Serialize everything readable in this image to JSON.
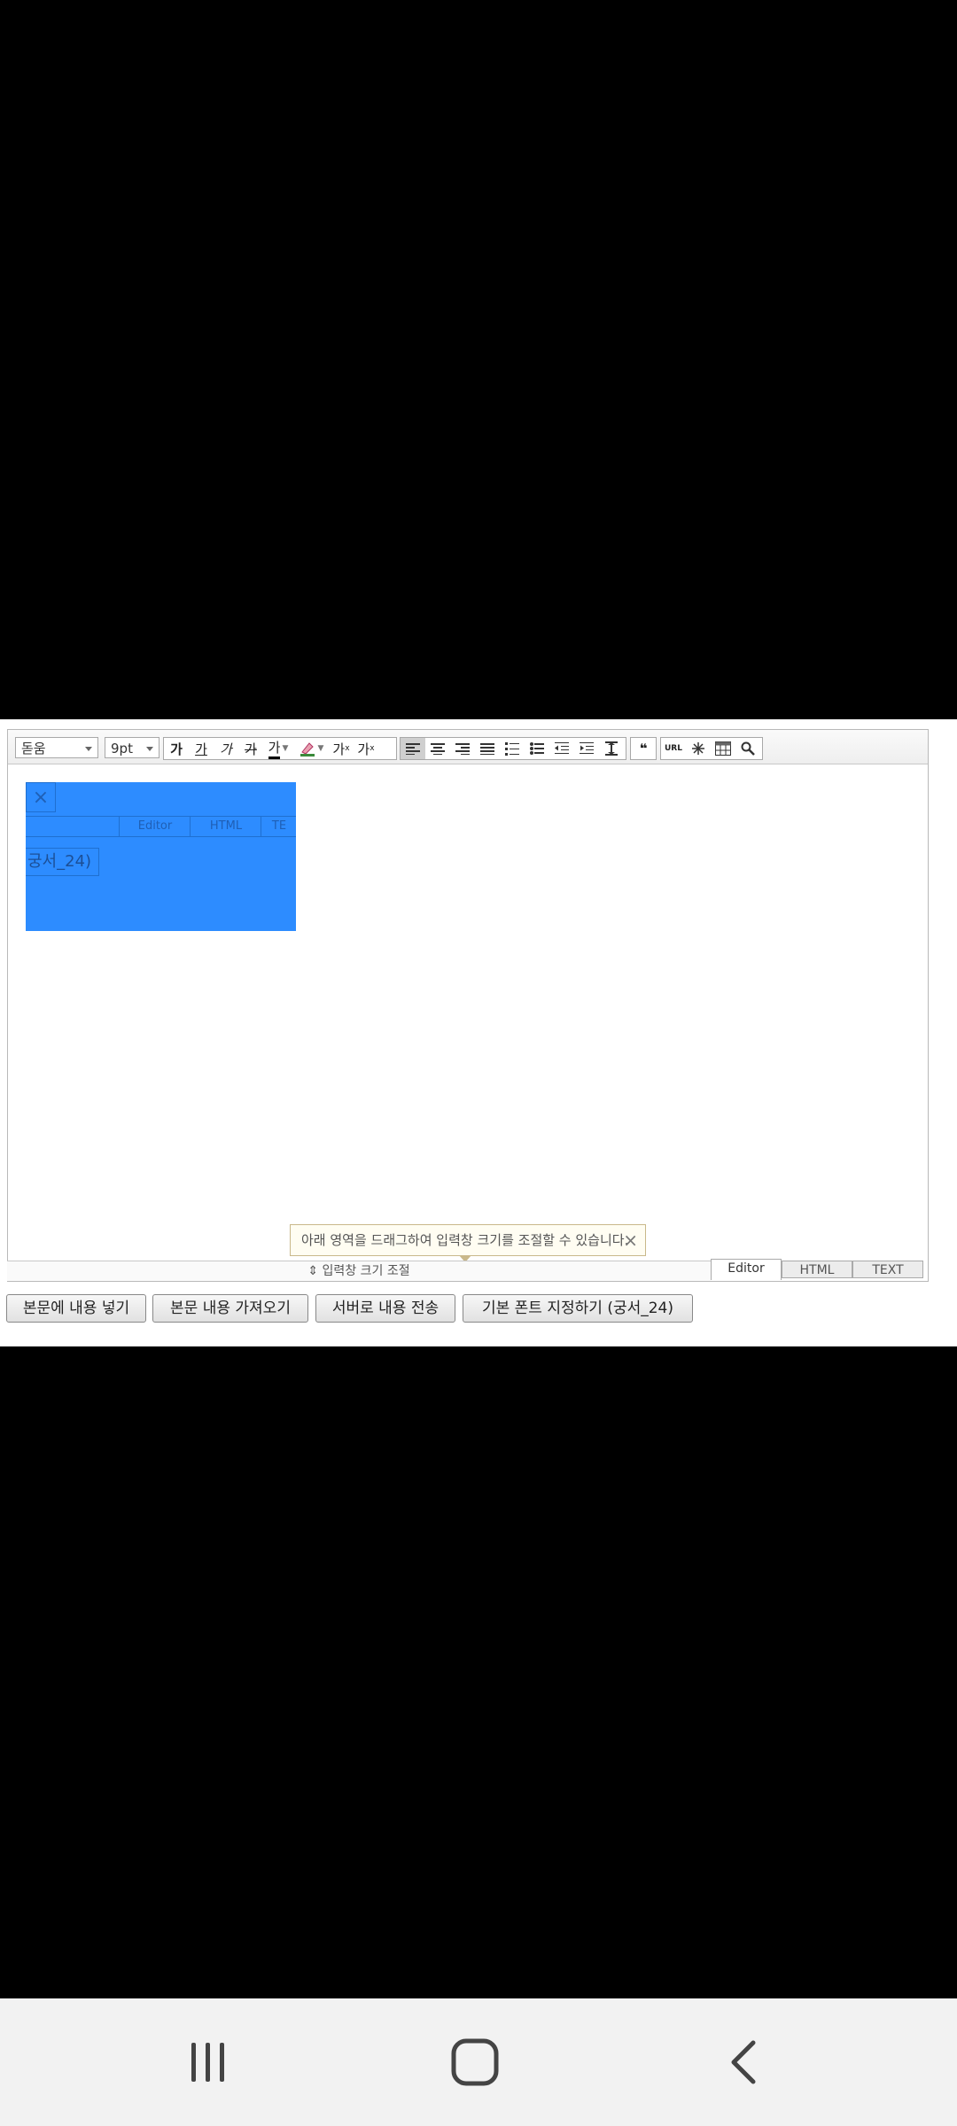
{
  "toolbar": {
    "font_family": "돋움",
    "font_size": "9pt",
    "text_format_buttons": [
      "가",
      "가",
      "가",
      "가",
      "가",
      "가",
      "가",
      "가"
    ],
    "icons": {
      "bold": "bold-icon",
      "underline": "underline-icon",
      "italic": "italic-icon",
      "strike": "strikethrough-icon",
      "font_color": "font-color-icon",
      "bg_color": "highlight-icon",
      "superscript": "superscript-icon",
      "subscript": "subscript-icon",
      "align_left": "align-left-icon",
      "align_center": "align-center-icon",
      "align_right": "align-right-icon",
      "align_justify": "align-justify-icon",
      "ordered_list": "ordered-list-icon",
      "unordered_list": "unordered-list-icon",
      "outdent": "outdent-icon",
      "indent": "indent-icon",
      "line_height": "line-height-icon",
      "quote": "quote-icon",
      "url": "link-icon",
      "special_char": "special-char-icon",
      "table": "table-icon",
      "find": "search-icon"
    },
    "quote_glyph": "❝",
    "url_label": "URL"
  },
  "selection": {
    "close_glyph": "×",
    "tabs": [
      "Editor",
      "HTML",
      "TE"
    ],
    "chip_text": "궁서_24)"
  },
  "tooltip": {
    "text": "아래 영역을 드래그하여 입력창 크기를 조절할 수 있습니다.",
    "close_glyph": "×"
  },
  "resize_bar": {
    "label": "⇕ 입력창 크기 조절"
  },
  "mode_tabs": [
    "Editor",
    "HTML",
    "TEXT"
  ],
  "actions": {
    "insert": "본문에 내용 넣기",
    "fetch": "본문 내용 가져오기",
    "send": "서버로 내용 전송",
    "default_font": "기본 폰트 지정하기 (궁서_24)"
  },
  "navbar": {
    "recents": "recents-icon",
    "home": "home-icon",
    "back": "back-icon"
  }
}
